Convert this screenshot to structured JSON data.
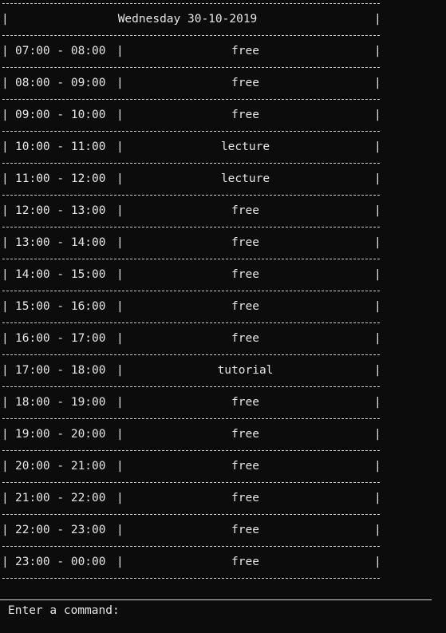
{
  "schedule": {
    "day_title": "Wednesday 30-10-2019",
    "slots": [
      {
        "time": "07:00 - 08:00",
        "activity": "free"
      },
      {
        "time": "08:00 - 09:00",
        "activity": "free"
      },
      {
        "time": "09:00 - 10:00",
        "activity": "free"
      },
      {
        "time": "10:00 - 11:00",
        "activity": "lecture"
      },
      {
        "time": "11:00 - 12:00",
        "activity": "lecture"
      },
      {
        "time": "12:00 - 13:00",
        "activity": "free"
      },
      {
        "time": "13:00 - 14:00",
        "activity": "free"
      },
      {
        "time": "14:00 - 15:00",
        "activity": "free"
      },
      {
        "time": "15:00 - 16:00",
        "activity": "free"
      },
      {
        "time": "16:00 - 17:00",
        "activity": "free"
      },
      {
        "time": "17:00 - 18:00",
        "activity": "tutorial"
      },
      {
        "time": "18:00 - 19:00",
        "activity": "free"
      },
      {
        "time": "19:00 - 20:00",
        "activity": "free"
      },
      {
        "time": "20:00 - 21:00",
        "activity": "free"
      },
      {
        "time": "21:00 - 22:00",
        "activity": "free"
      },
      {
        "time": "22:00 - 23:00",
        "activity": "free"
      },
      {
        "time": "23:00 - 00:00",
        "activity": "free"
      }
    ]
  },
  "separator_char": "|",
  "command": {
    "prompt": "Enter a command:",
    "value": ""
  }
}
